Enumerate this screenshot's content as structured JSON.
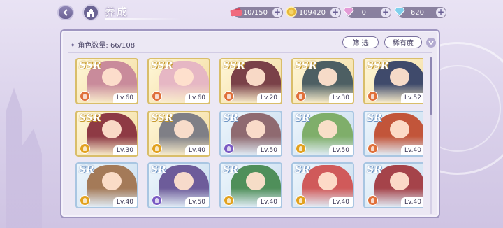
{
  "header": {
    "title": "养成"
  },
  "currencies": [
    {
      "name": "stamina",
      "icon": "ticket-stack-icon",
      "value": "810/150",
      "color": "#d9435a"
    },
    {
      "name": "gold",
      "icon": "gold-coin-icon",
      "value": "109420",
      "color": "#e8b83a"
    },
    {
      "name": "pink-gem",
      "icon": "pink-diamond-icon",
      "value": "0",
      "color": "#e49ad6"
    },
    {
      "name": "blue-gem",
      "icon": "blue-diamond-icon",
      "value": "620",
      "color": "#7fd0ec"
    }
  ],
  "panel": {
    "count_label": "角色数量: 66/108",
    "filter_label": "筛 选",
    "rarity_label": "稀有度"
  },
  "cards": [
    {
      "rarity": "SSR",
      "level": "Lv.60",
      "element": "#e0703a",
      "art": "#c98b9b"
    },
    {
      "rarity": "SSR",
      "level": "Lv.60",
      "element": "#e0703a",
      "art": "#e6b7c4"
    },
    {
      "rarity": "SSR",
      "level": "Lv.20",
      "element": "#e0703a",
      "art": "#7a4148"
    },
    {
      "rarity": "SSR",
      "level": "Lv.30",
      "element": "#e0703a",
      "art": "#4d5f63"
    },
    {
      "rarity": "SSR",
      "level": "Lv.52",
      "element": "#e0703a",
      "art": "#3f4a6b"
    },
    {
      "rarity": "SSR",
      "level": "Lv.30",
      "element": "#e2a21f",
      "art": "#8e3a44"
    },
    {
      "rarity": "SSR",
      "level": "Lv.40",
      "element": "#e2a21f",
      "art": "#7f7f86"
    },
    {
      "rarity": "SR",
      "level": "Lv.50",
      "element": "#7a5bc4",
      "art": "#8f6a70"
    },
    {
      "rarity": "SR",
      "level": "Lv.50",
      "element": "#e2a21f",
      "art": "#7fae6a"
    },
    {
      "rarity": "SR",
      "level": "Lv.40",
      "element": "#e0703a",
      "art": "#c2553a"
    },
    {
      "rarity": "SR",
      "level": "Lv.40",
      "element": "#e2a21f",
      "art": "#a47a58"
    },
    {
      "rarity": "SR",
      "level": "Lv.50",
      "element": "#7a5bc4",
      "art": "#6d5c9a"
    },
    {
      "rarity": "SR",
      "level": "Lv.40",
      "element": "#e2a21f",
      "art": "#4f8f5a"
    },
    {
      "rarity": "SR",
      "level": "Lv.40",
      "element": "#e2a21f",
      "art": "#d05a5a"
    },
    {
      "rarity": "SR",
      "level": "Lv.40",
      "element": "#e0703a",
      "art": "#a5434a"
    }
  ]
}
